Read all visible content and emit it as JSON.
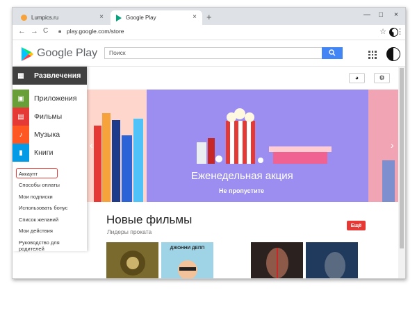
{
  "browser": {
    "tabs": [
      {
        "title": "Lumpics.ru",
        "close": "×"
      },
      {
        "title": "Google Play",
        "close": "×"
      }
    ],
    "new_tab": "+",
    "window_controls": {
      "minimize": "—",
      "maximize": "□",
      "close": "×"
    },
    "nav": {
      "back": "←",
      "forward": "→",
      "reload": "C"
    },
    "url": "play.google.com/store",
    "icons": [
      "lock-icon",
      "star-icon",
      "menu-icon"
    ]
  },
  "header": {
    "app_title": "Google Play",
    "search_placeholder": "Поиск",
    "search_button_icon": "search-icon"
  },
  "sidebar": {
    "categories": [
      {
        "label": "Развлечения",
        "icon": "apps-grid-icon",
        "color": "#404040",
        "active": true
      },
      {
        "label": "Приложения",
        "icon": "android-apps-icon",
        "color": "#689f38"
      },
      {
        "label": "Фильмы",
        "icon": "film-icon",
        "color": "#e53935"
      },
      {
        "label": "Музыка",
        "icon": "music-icon",
        "color": "#ff5722"
      },
      {
        "label": "Книги",
        "icon": "book-icon",
        "color": "#039be5"
      }
    ],
    "links": [
      "Аккаунт",
      "Способы оплаты",
      "Мои подписки",
      "Использовать бонус",
      "Список желаний",
      "Мои действия",
      "Руководство для",
      "родителей"
    ]
  },
  "main": {
    "top_buttons": [
      "help-icon",
      "gear-icon"
    ],
    "banner": {
      "title": "Еженедельная акция",
      "subtitle": "Не пропустите",
      "prev": "‹",
      "next": "›"
    },
    "section": {
      "title": "Новые фильмы",
      "subtitle": "Лидеры проката",
      "more_button": "Ещё",
      "posters": [
        {
          "label": "",
          "color": "#7a6a2e"
        },
        {
          "label": "ДЖОННИ ДЕПП",
          "color": "#9fd3e6"
        },
        {
          "label": "",
          "color": "#2b2220"
        },
        {
          "label": "",
          "color": "#1f3a5c"
        }
      ]
    }
  },
  "colors": {
    "accent_red": "#e53935",
    "search_blue": "#4285f4",
    "banner_purple": "#9b8ef0"
  }
}
